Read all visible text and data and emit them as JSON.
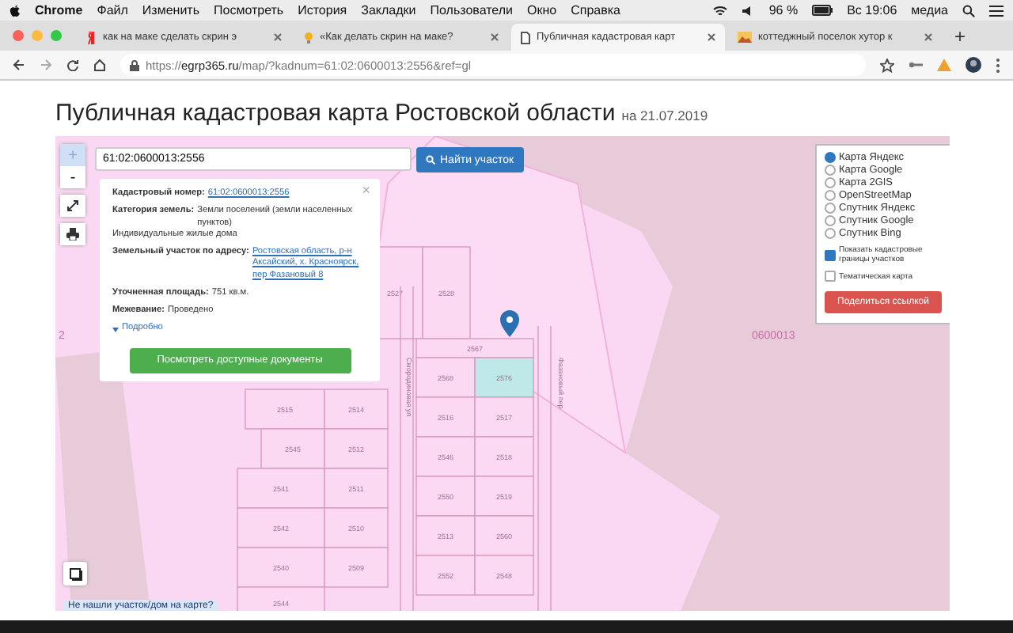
{
  "menubar": {
    "app": "Chrome",
    "items": [
      "Файл",
      "Изменить",
      "Посмотреть",
      "История",
      "Закладки",
      "Пользователи",
      "Окно",
      "Справка"
    ],
    "battery": "96 %",
    "clock": "Вс 19:06",
    "user": "медиа"
  },
  "tabs": [
    {
      "title": "как на маке сделать скрин э",
      "selected": false
    },
    {
      "title": "«Как делать скрин на маке?",
      "selected": false
    },
    {
      "title": "Публичная кадастровая карт",
      "selected": true
    },
    {
      "title": "коттеджный поселок хутор к",
      "selected": false
    }
  ],
  "new_tab": "+",
  "address_bar": {
    "url": "https://**egrp365.ru**/map/?kadnum=61:02:0600013:2556&ref=gl"
  },
  "page": {
    "title": "Публичная кадастровая карта Ростовской области",
    "date": "на 21.07.2019"
  },
  "map": {
    "zoom_in": {
      "label": "+",
      "disabled": true
    },
    "zoom_out": {
      "label": "-",
      "disabled": false
    },
    "search": {
      "value": "61:02:0600013:2556",
      "button": "Найти участок"
    },
    "popup": {
      "close": "×",
      "fields": [
        {
          "label": "Кадастровый номер:",
          "value": "61:02:0600013:2556",
          "kind": "link"
        },
        {
          "label": "Категория земель:",
          "value": "Земли поселений (земли населенных пунктов)",
          "note": "Индивидуальные жилые дома",
          "kind": "text"
        },
        {
          "label": "Земельный участок по адресу:",
          "value": "Ростовская область, р-н Аксайский, х. Красноярск, пер Фазановый 8",
          "kind": "link"
        },
        {
          "label": "Уточненная площадь:",
          "value": "751 кв.м.",
          "kind": "text"
        },
        {
          "label": "Межевание:",
          "value": "Проведено",
          "kind": "text"
        }
      ],
      "more": "Подробно",
      "button": "Посмотреть доступные документы"
    },
    "layers": {
      "base": [
        {
          "label": "Карта Яндекс",
          "selected": true
        },
        {
          "label": "Карта Google",
          "selected": false
        },
        {
          "label": "Карта 2GIS",
          "selected": false
        },
        {
          "label": "OpenStreetMap",
          "selected": false
        },
        {
          "label": "Спутник Яндекс",
          "selected": false
        },
        {
          "label": "Спутник Google",
          "selected": false
        },
        {
          "label": "Спутник Bing",
          "selected": false
        }
      ],
      "overlays": [
        {
          "label": "Показать кадастровые границы участков",
          "checked": true
        },
        {
          "label": "Тематическая карта",
          "checked": false
        }
      ],
      "share": "Поделиться ссылкой"
    },
    "labels": [
      "2",
      "0600013"
    ],
    "streets": [
      "Смородиновая ул",
      "Фазановый пер"
    ],
    "parcels": [
      {
        "number": "2527",
        "selected": false
      },
      {
        "number": "2528",
        "selected": false
      },
      {
        "number": "2567",
        "selected": false
      },
      {
        "number": "2568",
        "selected": false
      },
      {
        "number": "2576",
        "selected": true
      },
      {
        "number": "2516",
        "selected": false
      },
      {
        "number": "2517",
        "selected": false
      },
      {
        "number": "2546",
        "selected": false
      },
      {
        "number": "2518",
        "selected": false
      },
      {
        "number": "2550",
        "selected": false
      },
      {
        "number": "2519",
        "selected": false
      },
      {
        "number": "2513",
        "selected": false
      },
      {
        "number": "2560",
        "selected": false
      },
      {
        "number": "2552",
        "selected": false
      },
      {
        "number": "2548",
        "selected": false
      },
      {
        "number": "2515",
        "selected": false
      },
      {
        "number": "2514",
        "selected": false
      },
      {
        "number": "2545",
        "selected": false
      },
      {
        "number": "2512",
        "selected": false
      },
      {
        "number": "2541",
        "selected": false
      },
      {
        "number": "2511",
        "selected": false
      },
      {
        "number": "2542",
        "selected": false
      },
      {
        "number": "2510",
        "selected": false
      },
      {
        "number": "2540",
        "selected": false
      },
      {
        "number": "2509",
        "selected": false
      },
      {
        "number": "2544",
        "selected": false
      }
    ],
    "not_found_link": "Не нашли участок/дом на карте?"
  }
}
